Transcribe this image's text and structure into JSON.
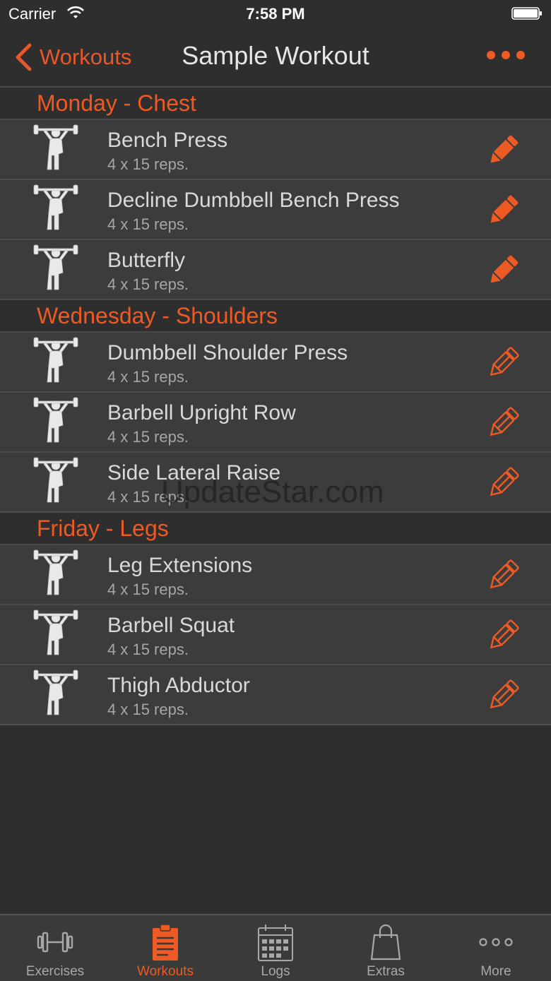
{
  "status": {
    "carrier": "Carrier",
    "time": "7:58 PM"
  },
  "nav": {
    "back_label": "Workouts",
    "title": "Sample Workout"
  },
  "sections": [
    {
      "title": "Monday - Chest",
      "exercises": [
        {
          "name": "Bench Press",
          "detail": "4 x 15 reps.",
          "edit_style": "filled"
        },
        {
          "name": "Decline Dumbbell Bench Press",
          "detail": "4 x 15 reps.",
          "edit_style": "filled"
        },
        {
          "name": "Butterfly",
          "detail": "4 x 15 reps.",
          "edit_style": "filled"
        }
      ]
    },
    {
      "title": "Wednesday - Shoulders",
      "exercises": [
        {
          "name": "Dumbbell Shoulder Press",
          "detail": "4 x 15 reps.",
          "edit_style": "outline"
        },
        {
          "name": "Barbell Upright Row",
          "detail": "4 x 15 reps.",
          "edit_style": "outline"
        },
        {
          "name": "Side Lateral Raise",
          "detail": "4 x 15 reps.",
          "edit_style": "outline"
        }
      ]
    },
    {
      "title": "Friday - Legs",
      "exercises": [
        {
          "name": "Leg Extensions",
          "detail": "4 x 15 reps.",
          "edit_style": "outline"
        },
        {
          "name": "Barbell Squat",
          "detail": "4 x 15 reps.",
          "edit_style": "outline"
        },
        {
          "name": "Thigh Abductor",
          "detail": "4 x 15 reps.",
          "edit_style": "outline"
        }
      ]
    }
  ],
  "watermark": "UpdateStar.com",
  "tabs": [
    {
      "label": "Exercises",
      "icon": "dumbbell-icon",
      "active": false
    },
    {
      "label": "Workouts",
      "icon": "clipboard-icon",
      "active": true
    },
    {
      "label": "Logs",
      "icon": "calendar-icon",
      "active": false
    },
    {
      "label": "Extras",
      "icon": "shopping-bag-icon",
      "active": false
    },
    {
      "label": "More",
      "icon": "more-dots-icon",
      "active": false
    }
  ],
  "colors": {
    "accent": "#ee5a24",
    "background": "#2e2e2e",
    "row": "#3c3c3c"
  }
}
